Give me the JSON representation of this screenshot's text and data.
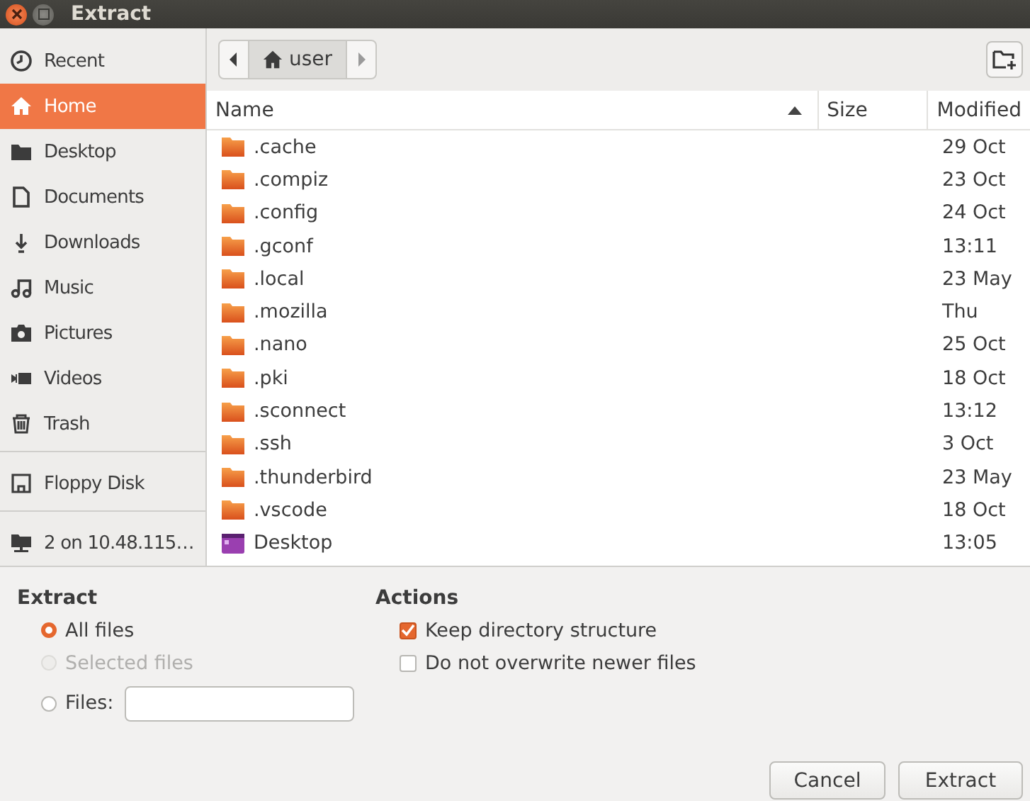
{
  "window": {
    "title": "Extract"
  },
  "sidebar": {
    "groups": [
      {
        "items": [
          {
            "label": "Recent",
            "selected": false
          },
          {
            "label": "Home",
            "selected": true
          },
          {
            "label": "Desktop",
            "selected": false
          },
          {
            "label": "Documents",
            "selected": false
          },
          {
            "label": "Downloads",
            "selected": false
          },
          {
            "label": "Music",
            "selected": false
          },
          {
            "label": "Pictures",
            "selected": false
          },
          {
            "label": "Videos",
            "selected": false
          },
          {
            "label": "Trash",
            "selected": false
          }
        ]
      },
      {
        "items": [
          {
            "label": "Floppy Disk",
            "selected": false
          }
        ]
      },
      {
        "items": [
          {
            "label": "2 on 10.48.115…",
            "selected": false
          }
        ]
      }
    ]
  },
  "pathbar": {
    "segments": [
      {
        "label": "user",
        "selected": true
      }
    ]
  },
  "table": {
    "columns": [
      "Name",
      "Size",
      "Modified"
    ],
    "rows": [
      {
        "kind": "folder",
        "name": ".cache",
        "modified": "29 Oct"
      },
      {
        "kind": "folder",
        "name": ".compiz",
        "modified": "23 Oct"
      },
      {
        "kind": "folder",
        "name": ".config",
        "modified": "24 Oct"
      },
      {
        "kind": "folder",
        "name": ".gconf",
        "modified": "13:11"
      },
      {
        "kind": "folder",
        "name": ".local",
        "modified": "23 May"
      },
      {
        "kind": "folder",
        "name": ".mozilla",
        "modified": "Thu"
      },
      {
        "kind": "folder",
        "name": ".nano",
        "modified": "25 Oct"
      },
      {
        "kind": "folder",
        "name": ".pki",
        "modified": "18 Oct"
      },
      {
        "kind": "folder",
        "name": ".sconnect",
        "modified": "13:12"
      },
      {
        "kind": "folder",
        "name": ".ssh",
        "modified": "3 Oct"
      },
      {
        "kind": "folder",
        "name": ".thunderbird",
        "modified": "23 May"
      },
      {
        "kind": "folder",
        "name": ".vscode",
        "modified": "18 Oct"
      },
      {
        "kind": "desktop",
        "name": "Desktop",
        "modified": "13:05"
      }
    ]
  },
  "extract": {
    "title": "Extract",
    "options": [
      {
        "label": "All files",
        "selected": true,
        "disabled": false
      },
      {
        "label": "Selected files",
        "selected": false,
        "disabled": true
      },
      {
        "label": "Files:",
        "selected": false,
        "disabled": false
      }
    ]
  },
  "actions": {
    "title": "Actions",
    "options": [
      {
        "label": "Keep directory structure",
        "checked": true
      },
      {
        "label": "Do not overwrite newer files",
        "checked": false
      }
    ]
  },
  "buttons": [
    "Cancel",
    "Extract"
  ]
}
